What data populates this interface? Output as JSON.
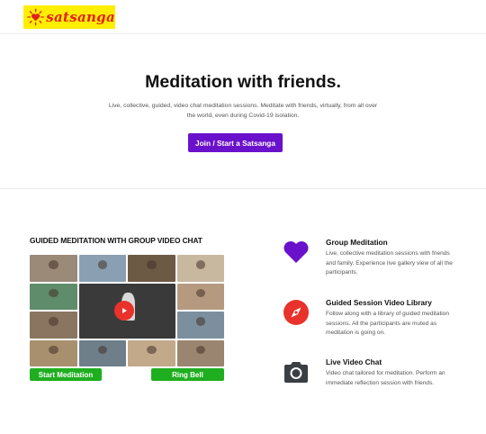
{
  "brand": {
    "logo_text": "satsanga",
    "logo_bg": "#ffee00",
    "logo_color": "#e0221a"
  },
  "hero": {
    "title": "Meditation with friends.",
    "subtitle": "Live, collective, guided, video chat meditation sessions. Meditate with friends, virtually, from all over the world, even during Covid-19 isolation.",
    "cta_label": "Join / Start a Satsanga",
    "cta_color": "#6a11cb"
  },
  "demo": {
    "title": "GUIDED MEDITATION WITH GROUP VIDEO CHAT",
    "start_label": "Start Meditation",
    "bell_label": "Ring Bell",
    "button_color": "#1fae1f",
    "record_icon": "record-icon",
    "tile_colors": [
      "#9c8a78",
      "#8aa0b2",
      "#6d5a45",
      "#c9b8a0",
      "#5f8c6a",
      "#b59a80",
      "#8a7560",
      "#7c8f9e",
      "#a88f6e",
      "#6f7f8a",
      "#c2a98a",
      "#9a8570",
      "#7a6a5a",
      "#b0a290"
    ]
  },
  "features": [
    {
      "title": "Group Meditation",
      "description": "Live, collective meditation sessions with friends and family. Experience live gallery view of all the participants.",
      "icon": "heart-icon",
      "icon_color": "#6a11cb"
    },
    {
      "title": "Guided Session Video Library",
      "description": "Follow along with a library of guided meditation sessions. All the participants are muted as meditation is going on.",
      "icon": "compass-icon",
      "icon_color": "#e8322b"
    },
    {
      "title": "Live Video Chat",
      "description": "Video chat tailored for meditation. Perform an immediate reflection session with friends.",
      "icon": "camera-icon",
      "icon_color": "#3a3f44"
    }
  ]
}
